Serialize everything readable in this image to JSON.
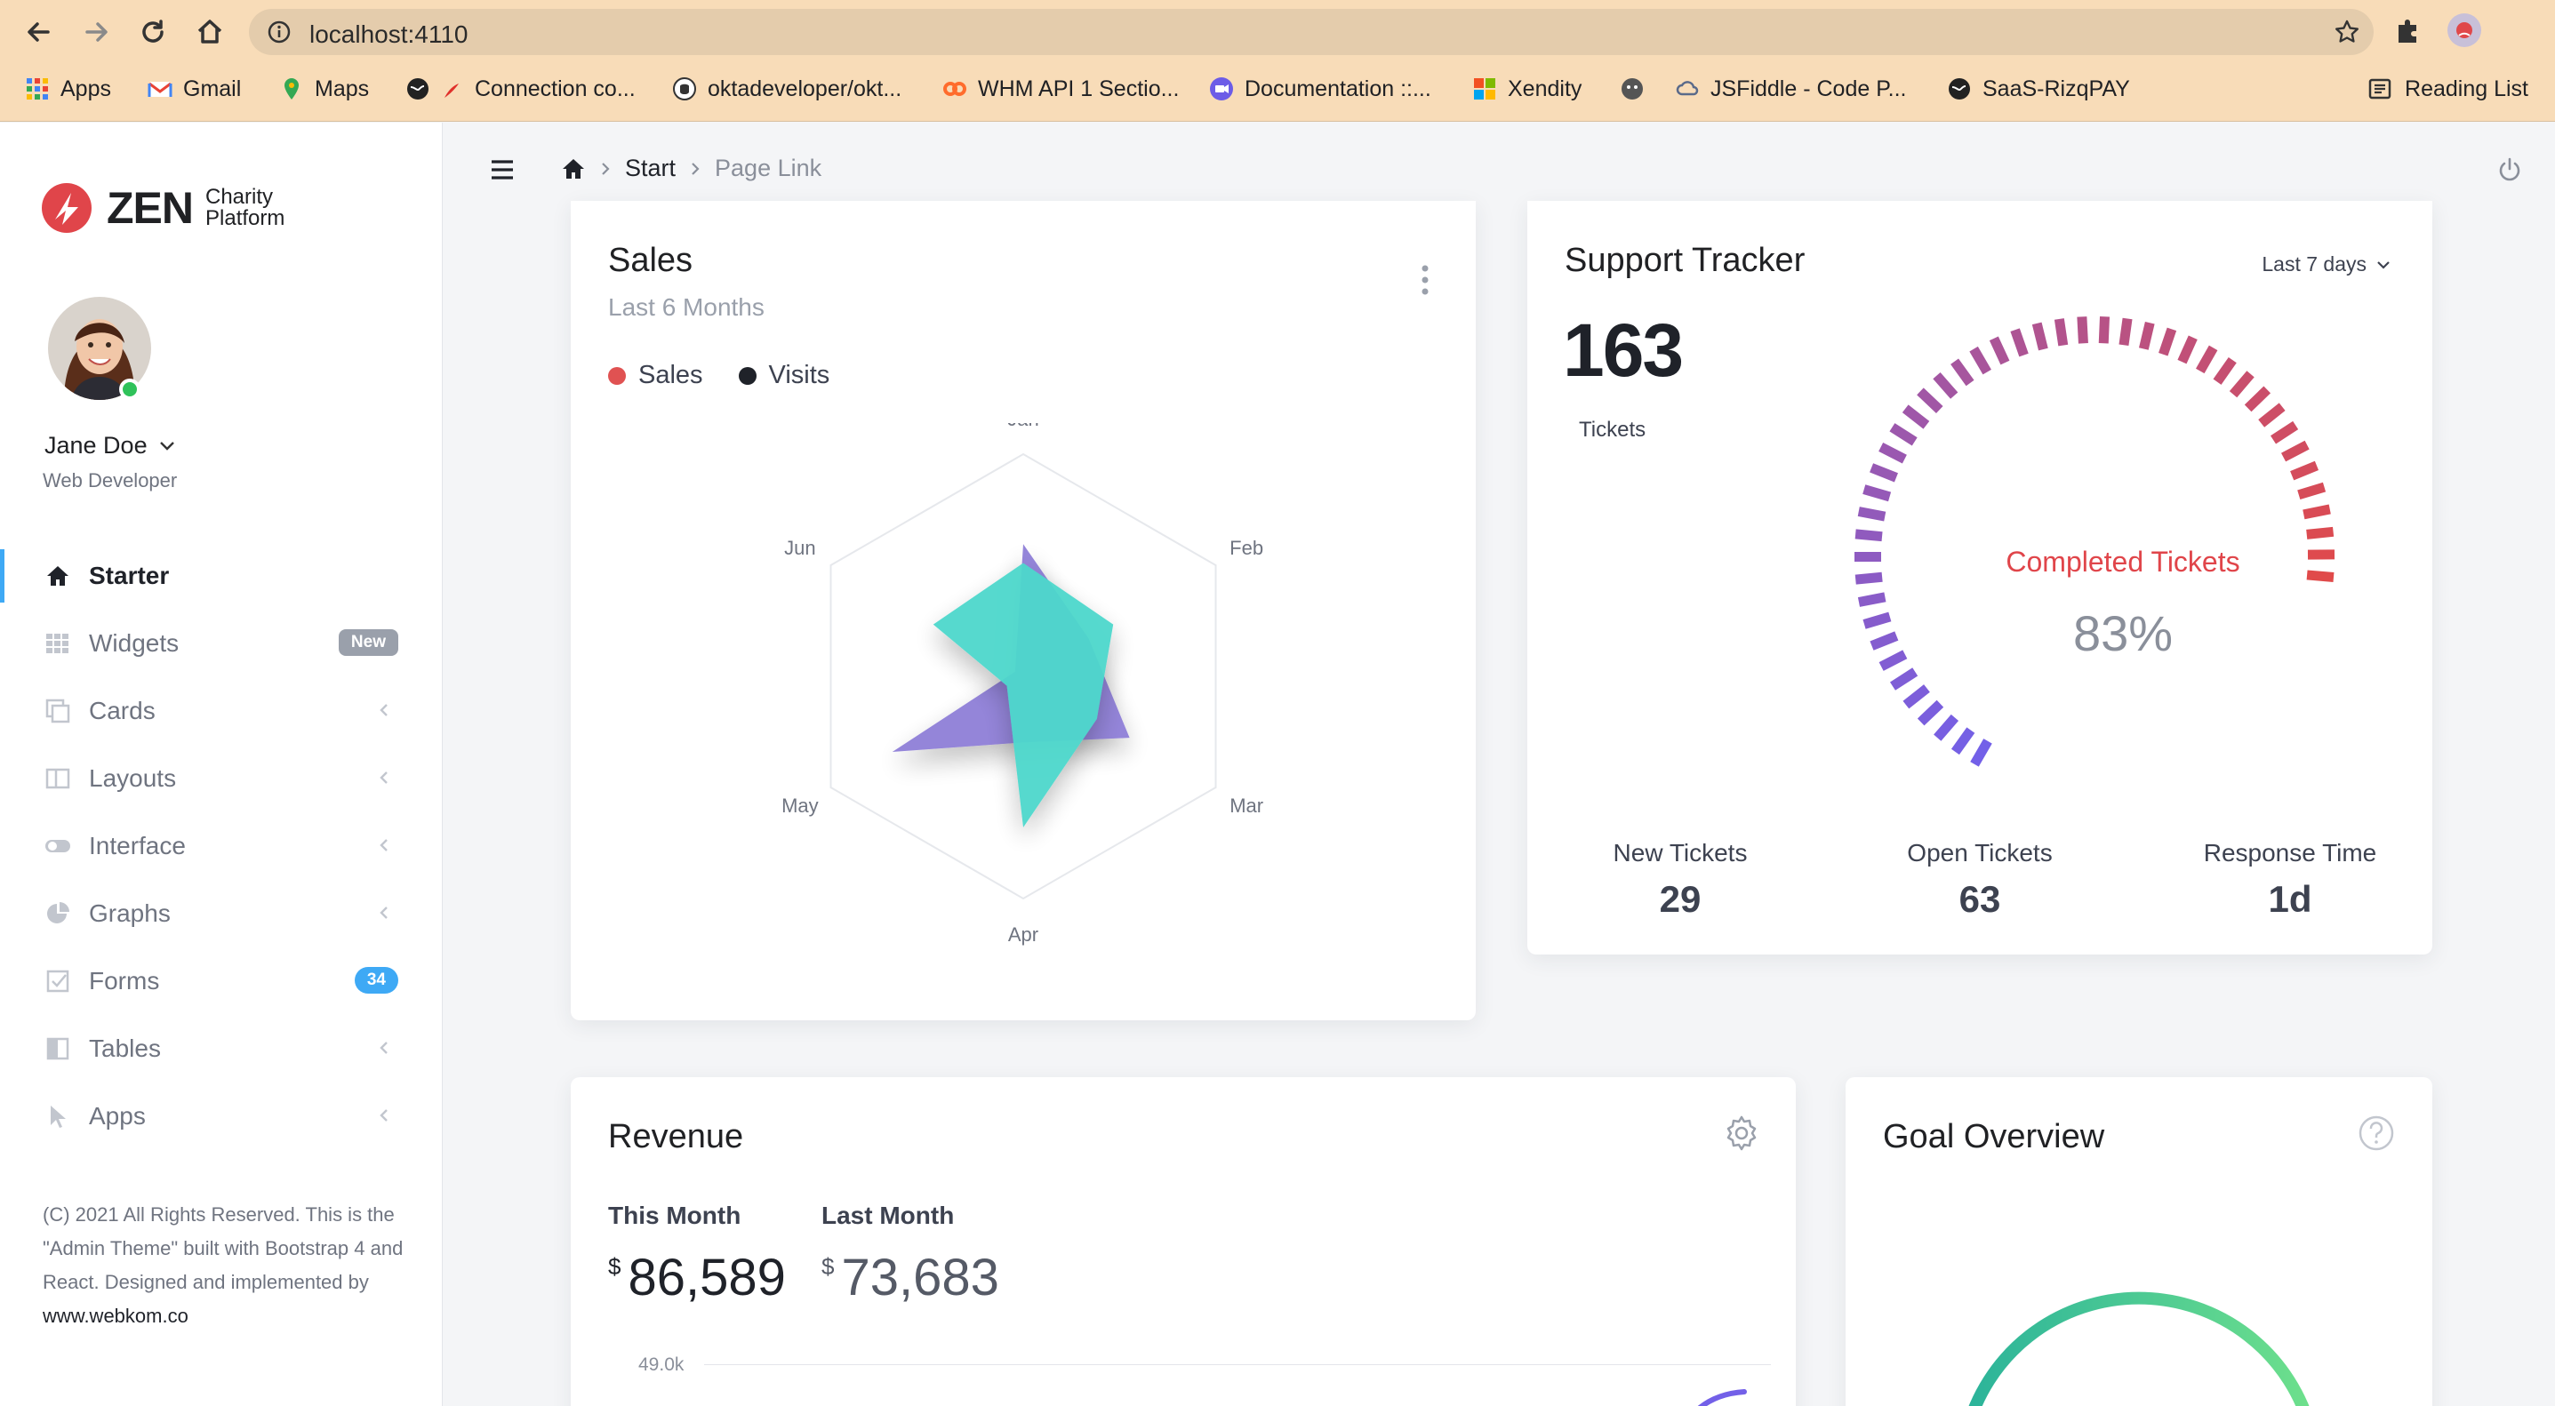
{
  "browser": {
    "url": "localhost:4110",
    "bookmarks": [
      "Apps",
      "Gmail",
      "Maps",
      "Connection co...",
      "oktadeveloper/okt...",
      "WHM API 1 Sectio...",
      "Documentation ::...",
      "Xendity",
      "JSFiddle - Code P...",
      "SaaS-RizqPAY"
    ],
    "reading_list": "Reading List"
  },
  "brand": {
    "name": "ZEN",
    "sub_line1": "Charity",
    "sub_line2": "Platform"
  },
  "user": {
    "name": "Jane Doe",
    "role": "Web Developer",
    "status": "online"
  },
  "menu": {
    "items": [
      {
        "label": "Starter",
        "icon": "home-icon",
        "active": true
      },
      {
        "label": "Widgets",
        "icon": "grid-icon",
        "badge": "New"
      },
      {
        "label": "Cards",
        "icon": "cards-icon"
      },
      {
        "label": "Layouts",
        "icon": "layout-icon"
      },
      {
        "label": "Interface",
        "icon": "toggle-icon"
      },
      {
        "label": "Graphs",
        "icon": "pie-icon"
      },
      {
        "label": "Forms",
        "icon": "checkbox-icon",
        "badge": "34"
      },
      {
        "label": "Tables",
        "icon": "table-icon"
      },
      {
        "label": "Apps",
        "icon": "cursor-icon"
      }
    ]
  },
  "footer": {
    "text": "(C) 2021 All Rights Reserved. This is the \"Admin Theme\" built with Bootstrap 4 and React. Designed and implemented by ",
    "link": "www.webkom.co"
  },
  "breadcrumb": {
    "start": "Start",
    "current": "Page Link"
  },
  "sales": {
    "title": "Sales",
    "subtitle": "Last 6 Months",
    "legend": {
      "sales": "Sales",
      "visits": "Visits"
    }
  },
  "chart_data": {
    "type": "radar",
    "categories": [
      "Jan",
      "Feb",
      "Mar",
      "Apr",
      "May",
      "Jun"
    ],
    "series": [
      {
        "name": "Sales",
        "color": "#4dd8cc",
        "values": [
          0.6,
          0.55,
          0.45,
          0.8,
          0.1,
          0.55
        ]
      },
      {
        "name": "Visits",
        "color": "#8f7fd8",
        "values": [
          0.7,
          0.4,
          0.65,
          0.35,
          0.8,
          0.05
        ]
      }
    ],
    "ylim": [
      0,
      1
    ]
  },
  "support": {
    "title": "Support Tracker",
    "range": "Last 7 days",
    "tickets": "163",
    "tickets_label": "Tickets",
    "gauge_label": "Completed Tickets",
    "gauge_value": "83%",
    "gauge_fraction": 0.83,
    "stats": [
      {
        "label": "New Tickets",
        "value": "29"
      },
      {
        "label": "Open Tickets",
        "value": "63"
      },
      {
        "label": "Response Time",
        "value": "1d"
      }
    ],
    "colors": {
      "start": "#7360e8",
      "end": "#e04a4a"
    }
  },
  "revenue": {
    "title": "Revenue",
    "this_month_label": "This Month",
    "this_month_currency": "$",
    "this_month_value": "86,589",
    "last_month_label": "Last Month",
    "last_month_currency": "$",
    "last_month_value": "73,683",
    "axis_top": "49.0k"
  },
  "goal": {
    "title": "Goal Overview",
    "ring_color": "#3ccf9a"
  }
}
